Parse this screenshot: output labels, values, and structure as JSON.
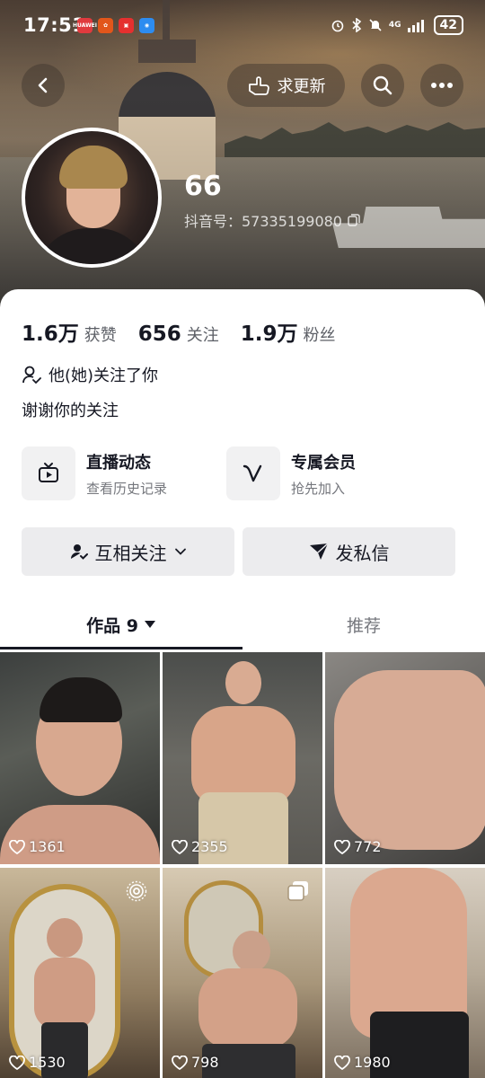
{
  "status_bar": {
    "time": "17:51",
    "network": "4G",
    "battery": "42",
    "app_icons": [
      {
        "name": "huawei-app-icon",
        "label": "HUAWEI",
        "color": "#e03a3e"
      },
      {
        "name": "gallery-app-icon",
        "label": "",
        "color": "#e2561b"
      },
      {
        "name": "red-app-icon",
        "label": "",
        "color": "#e5302f"
      },
      {
        "name": "blue-app-icon",
        "label": "",
        "color": "#2d8cf0"
      }
    ]
  },
  "header": {
    "back_icon": "chevron-left-icon",
    "update_label": "求更新",
    "search_icon": "search-icon",
    "more_icon": "more-icon"
  },
  "profile": {
    "nickname": "66",
    "douyin_id": "抖音号：57335199080",
    "copy_icon": "copy-icon"
  },
  "stats": [
    {
      "value": "1.6万",
      "label": "获赞"
    },
    {
      "value": "656",
      "label": "关注"
    },
    {
      "value": "1.9万",
      "label": "粉丝"
    }
  ],
  "follow_status": "他(她)关注了你",
  "bio": "谢谢你的关注",
  "features": [
    {
      "title": "直播动态",
      "subtitle": "查看历史记录",
      "icon": "tv-icon"
    },
    {
      "title": "专属会员",
      "subtitle": "抢先加入",
      "icon": "member-v-icon"
    }
  ],
  "actions": {
    "mutual_follow": "互相关注",
    "message": "发私信"
  },
  "tabs": [
    {
      "label": "作品 9",
      "active": true
    },
    {
      "label": "推荐",
      "active": false
    }
  ],
  "videos": [
    {
      "likes": "1361"
    },
    {
      "likes": "2355"
    },
    {
      "likes": "772"
    },
    {
      "likes": "1530",
      "badge": "live-photo-icon"
    },
    {
      "likes": "798",
      "badge": "multi-image-icon"
    },
    {
      "likes": "1980"
    }
  ],
  "colors": {
    "text_primary": "#161823",
    "text_secondary": "#75777d",
    "button_bg": "#ececee"
  }
}
